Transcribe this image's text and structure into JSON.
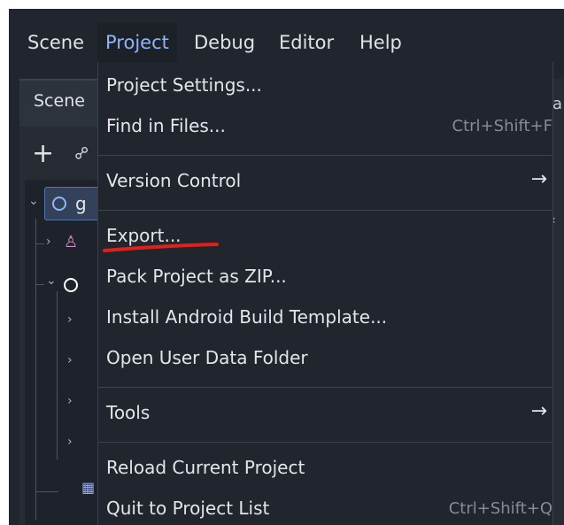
{
  "menubar": {
    "items": [
      {
        "label": "Scene"
      },
      {
        "label": "Project",
        "active": true
      },
      {
        "label": "Debug"
      },
      {
        "label": "Editor"
      },
      {
        "label": "Help"
      }
    ]
  },
  "dock": {
    "tab_label": "Scene",
    "right_partial": "a"
  },
  "tree": {
    "root_label": "g"
  },
  "project_menu": {
    "items": [
      {
        "label": "Project Settings...",
        "shortcut": ""
      },
      {
        "label": "Find in Files...",
        "shortcut": "Ctrl+Shift+F"
      },
      {
        "label": "Version Control",
        "submenu": true
      },
      {
        "label": "Export...",
        "highlighted_annotation": true
      },
      {
        "label": "Pack Project as ZIP..."
      },
      {
        "label": "Install Android Build Template..."
      },
      {
        "label": "Open User Data Folder"
      },
      {
        "label": "Tools",
        "submenu": true
      },
      {
        "label": "Reload Current Project"
      },
      {
        "label": "Quit to Project List",
        "shortcut": "Ctrl+Shift+Q"
      }
    ]
  },
  "colors": {
    "background": "#20252e",
    "menu_text": "#e3e5e9",
    "accent": "#8fb5f8",
    "shortcut_text": "#868c96",
    "annotation_red": "#e0201c"
  },
  "icons": {
    "submenu_arrow": "→",
    "add": "+",
    "link": "🔗"
  }
}
